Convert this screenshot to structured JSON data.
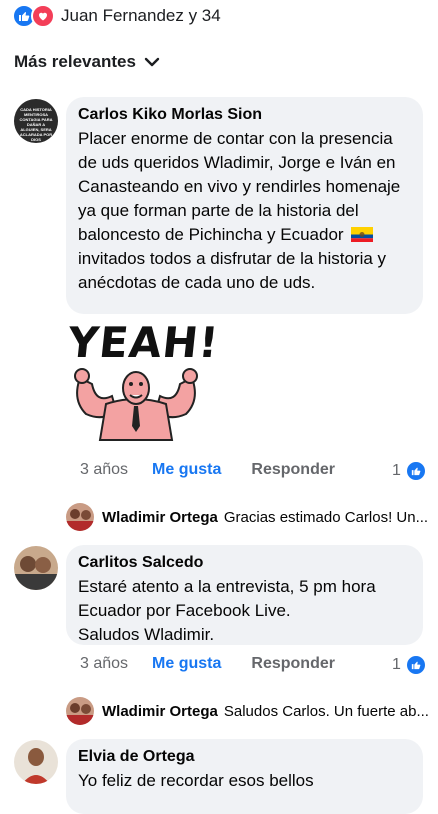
{
  "reactions": {
    "summary": "Juan Fernandez y 34",
    "icons": [
      "like-icon",
      "love-icon"
    ]
  },
  "sort": {
    "label": "Más relevantes"
  },
  "comments": [
    {
      "author": "Carlos Kiko Morlas Sion",
      "text_before_flag": "Placer enorme de contar con la presencia de uds queridos Wladimir, Jorge e Iván en Canasteando en vivo y rendirles homenaje ya que forman parte de la historia del baloncesto de Pichincha y Ecuador",
      "text_after_flag": "invitados todos a disfrutar de la historia y anécdotas de cada uno de uds.",
      "avatar_text": "CADA HISTORIA MENTIROSA CONTAGIA PARA DAÑAR A ALGUIEN, SERA ACLARADA POR DIOS",
      "sticker_text": "YEAH!",
      "time": "3 años",
      "like": "Me gusta",
      "reply": "Responder",
      "like_count": "1",
      "reply_preview": {
        "author": "Wladimir Ortega",
        "text": "Gracias estimado Carlos! Un..."
      }
    },
    {
      "author": "Carlitos Salcedo",
      "line1": "Estaré atento a la entrevista, 5 pm hora",
      "line2": "Ecuador por Facebook Live.",
      "line3": "Saludos Wladimir.",
      "time": "3 años",
      "like": "Me gusta",
      "reply": "Responder",
      "like_count": "1",
      "reply_preview": {
        "author": "Wladimir Ortega",
        "text": "Saludos Carlos. Un fuerte ab..."
      }
    },
    {
      "author": "Elvia de Ortega",
      "text": "Yo feliz de recordar esos bellos"
    }
  ],
  "colors": {
    "accent": "#1877f2",
    "bubble": "#f0f2f5",
    "secondary_text": "#65676b",
    "love": "#f33e58"
  }
}
